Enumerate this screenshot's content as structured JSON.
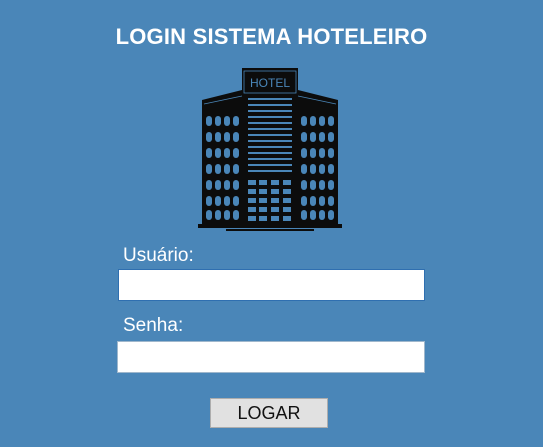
{
  "header": {
    "title": "LOGIN SISTEMA HOTELEIRO"
  },
  "logo": {
    "icon": "hotel-building-icon",
    "sign_text": "HOTEL",
    "color": "#0c0c0c"
  },
  "form": {
    "username_label": "Usuário:",
    "username_value": "",
    "password_label": "Senha:",
    "password_value": "",
    "submit_label": "LOGAR"
  },
  "colors": {
    "background": "#4a86b8",
    "text": "#ffffff",
    "button_bg": "#e1e1e1"
  }
}
